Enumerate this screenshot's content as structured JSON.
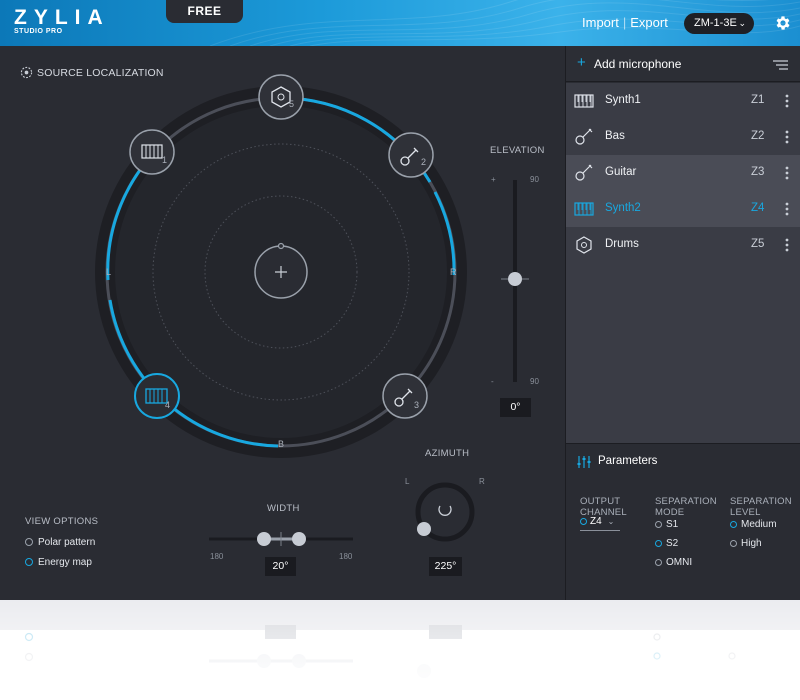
{
  "header": {
    "logo": "ZYLIA",
    "logo_sub": "STUDIO PRO",
    "free_tab": "FREE",
    "import": "Import",
    "separator": "|",
    "export": "Export",
    "device": "ZM-1-3E",
    "icons": {
      "device_dropdown": "chevron-down-icon",
      "settings": "gear-icon"
    }
  },
  "localization": {
    "title": "SOURCE LOCALIZATION",
    "side_labels": {
      "left": "L",
      "right": "R",
      "back": "B"
    },
    "sources": [
      {
        "zone": "5",
        "icon": "drum-icon",
        "active": false
      },
      {
        "zone": "1",
        "icon": "keyboard-icon",
        "active": false
      },
      {
        "zone": "2",
        "icon": "guitar-icon",
        "active": false
      },
      {
        "zone": "4",
        "icon": "keyboard-icon",
        "active": true
      },
      {
        "zone": "3",
        "icon": "guitar-icon",
        "active": false
      }
    ]
  },
  "elevation": {
    "title": "ELEVATION",
    "plus": "+",
    "minus": "-",
    "max_label": "90",
    "min_label": "90",
    "value": "0°"
  },
  "view_options": {
    "title": "VIEW OPTIONS",
    "options": [
      {
        "label": "Polar pattern",
        "selected": false
      },
      {
        "label": "Energy map",
        "selected": true
      }
    ]
  },
  "width": {
    "title": "WIDTH",
    "min_label": "180",
    "max_label": "180",
    "value": "20°"
  },
  "azimuth": {
    "title": "AZIMUTH",
    "left": "L",
    "right": "R",
    "value": "225°"
  },
  "microphones": {
    "add_label": "Add microphone",
    "items": [
      {
        "name": "Synth1",
        "zone": "Z1",
        "icon": "keyboard-icon",
        "state": "normal"
      },
      {
        "name": "Bas",
        "zone": "Z2",
        "icon": "guitar-icon",
        "state": "normal"
      },
      {
        "name": "Guitar",
        "zone": "Z3",
        "icon": "guitar-icon",
        "state": "selected"
      },
      {
        "name": "Synth2",
        "zone": "Z4",
        "icon": "keyboard-icon",
        "state": "active"
      },
      {
        "name": "Drums",
        "zone": "Z5",
        "icon": "drum-icon",
        "state": "normal"
      }
    ]
  },
  "parameters": {
    "title": "Parameters",
    "output_channel": {
      "title_line1": "OUTPUT",
      "title_line2": "CHANNEL",
      "value": "Z4"
    },
    "separation_mode": {
      "title_line1": "SEPARATION",
      "title_line2": "MODE",
      "options": [
        "S1",
        "S2",
        "OMNI"
      ],
      "selected": "S2"
    },
    "separation_level": {
      "title_line1": "SEPARATION",
      "title_line2": "LEVEL",
      "options": [
        "Medium",
        "High"
      ],
      "selected": "Medium"
    }
  },
  "colors": {
    "accent": "#18a8e0",
    "background": "#2a2c33",
    "header": "#1c9ad9"
  }
}
